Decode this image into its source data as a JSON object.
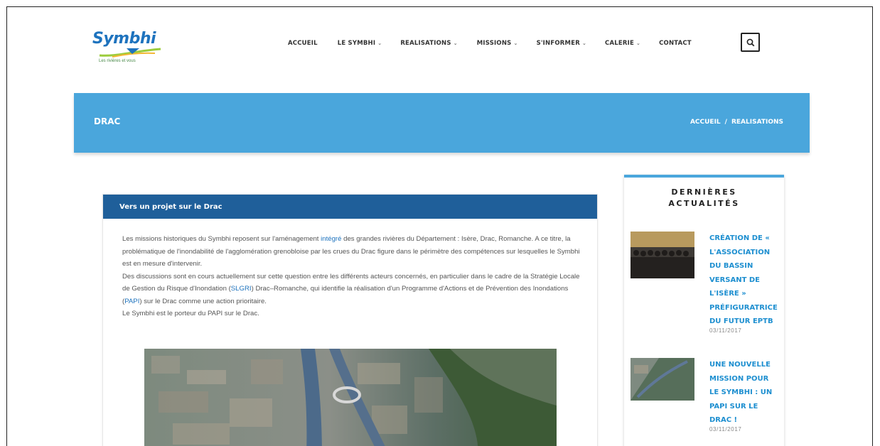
{
  "header": {
    "logo_text": "Symbhi",
    "logo_tagline": "Les rivières et vous",
    "nav": [
      {
        "label": "ACCUEIL",
        "dropdown": false
      },
      {
        "label": "LE SYMBHI",
        "dropdown": true
      },
      {
        "label": "REALISATIONS",
        "dropdown": true
      },
      {
        "label": "MISSIONS",
        "dropdown": true
      },
      {
        "label": "S'INFORMER",
        "dropdown": true
      },
      {
        "label": "CALERIE",
        "dropdown": true
      },
      {
        "label": "CONTACT",
        "dropdown": false
      }
    ],
    "search_icon": "search-icon"
  },
  "banner": {
    "title": "DRAC",
    "breadcrumb": [
      "ACCUEIL",
      "/",
      "REALISATIONS"
    ]
  },
  "article": {
    "title": "Vers un projet sur le Drac",
    "p1_a": "Les missions historiques du Symbhi reposent sur l'aménagement ",
    "p1_link": "intégré",
    "p1_b": " des grandes rivières du Département : Isère, Drac, Romanche. A ce titre, la problématique de l'inondabilité de l'agglomération grenobloise par les crues du Drac figure dans le périmètre des compétences sur lesquelles le Symbhi est en mesure d'intervenir.",
    "p2_a": "Des discussions sont en cours actuellement sur cette question entre les différents acteurs concernés, en particulier dans le cadre de la Stratégie Locale de Gestion du Risque d'Inondation (",
    "p2_link1": "SLGRI",
    "p2_b": ") Drac–Romanche, qui identifie la réalisation d'un Programme d'Actions et de Prévention des Inondations (",
    "p2_link2": "PAPI",
    "p2_c": ") sur le Drac comme une action prioritaire.",
    "p3": "Le Symbhi est le porteur du PAPI sur le Drac."
  },
  "sidebar": {
    "title_line1": "DERNIÈRES",
    "title_line2": "ACTUALITÉS",
    "news": [
      {
        "title": "CRÉATION DE « L'ASSOCIATION DU BASSIN VERSANT DE L'ISÈRE » PRÉFIGURATRICE DU FUTUR EPTB",
        "date": "03/11/2017"
      },
      {
        "title": "UNE NOUVELLE MISSION POUR LE SYMBHI : UN PAPI SUR LE DRAC !",
        "date": "03/11/2017"
      }
    ]
  },
  "colors": {
    "band": "#4aa6dc",
    "article_header": "#1f5f9a",
    "link": "#1e8fd0"
  }
}
